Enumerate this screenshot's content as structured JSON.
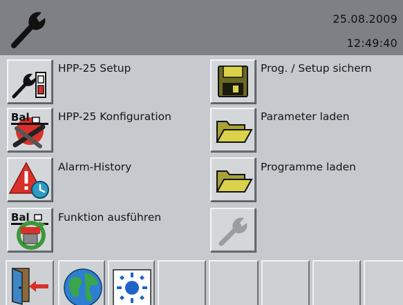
{
  "header": {
    "icon": "wrench-icon",
    "date": "25.08.2009",
    "time": "12:49:40"
  },
  "menu": {
    "left": [
      {
        "label": "HPP-25 Setup",
        "icon": "setup-wrench-icon"
      },
      {
        "label": "HPP-25 Konfiguration",
        "icon": "baltec-tools-icon",
        "icon_text": "Bal"
      },
      {
        "label": "Alarm-History",
        "icon": "alarm-warning-clock-icon"
      },
      {
        "label": "Funktion ausführen",
        "icon": "baltec-function-icon",
        "icon_text": "Bal"
      }
    ],
    "right": [
      {
        "label": "Prog. / Setup sichern",
        "icon": "floppy-disk-icon"
      },
      {
        "label": "Parameter laden",
        "icon": "folder-open-icon"
      },
      {
        "label": "Programme laden",
        "icon": "folder-open-icon"
      },
      {
        "label": "",
        "icon": "wrench-disabled-icon"
      }
    ]
  },
  "toolbar": [
    {
      "icon": "exit-door-icon"
    },
    {
      "icon": "globe-icon"
    },
    {
      "icon": "brightness-sun-icon"
    },
    {
      "icon": ""
    },
    {
      "icon": ""
    },
    {
      "icon": ""
    },
    {
      "icon": ""
    },
    {
      "icon": ""
    }
  ],
  "colors": {
    "header_bg": "#7d8085",
    "screen_bg": "#c6c9cd",
    "button_face": "#d4d7da",
    "alarm_red": "#d8302a",
    "folder_yellow": "#d9d24a",
    "floppy_olive": "#6b6a22"
  }
}
